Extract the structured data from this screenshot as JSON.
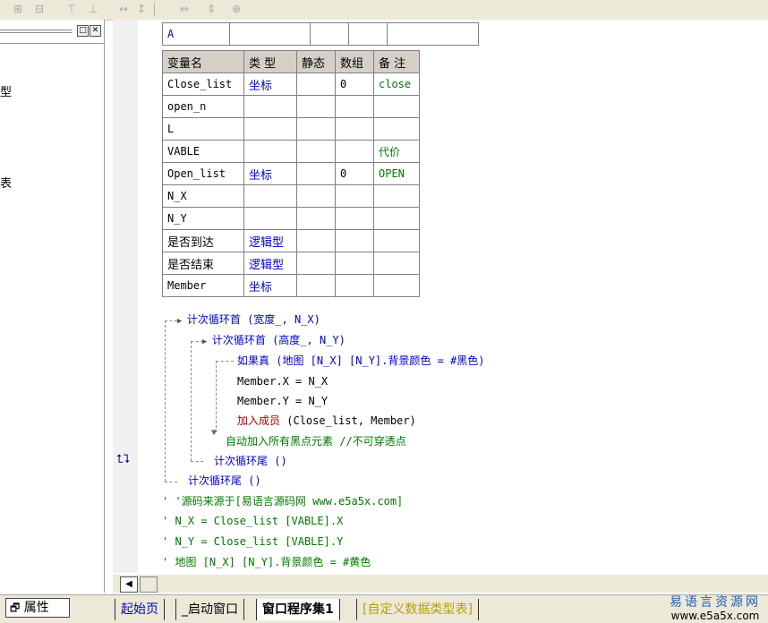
{
  "toolbar": {
    "icons": [
      "align-left-icon",
      "align-center-icon",
      "align-top-icon",
      "align-middle-icon",
      "equal-width-icon",
      "equal-height-icon",
      "equal-hspace-icon",
      "equal-vspace-icon",
      "center-both-icon"
    ]
  },
  "left_panel": {
    "fragments": [
      "型",
      "表"
    ]
  },
  "editor": {
    "header_row": [
      "A",
      "",
      "",
      "",
      ""
    ],
    "var_table": {
      "headers": [
        "变量名",
        "类 型",
        "静态",
        "数组",
        "备 注"
      ],
      "rows": [
        [
          "Close_list",
          "坐标",
          "",
          "0",
          "close"
        ],
        [
          "open_n",
          "",
          "",
          "",
          ""
        ],
        [
          "L",
          "",
          "",
          "",
          ""
        ],
        [
          "VABLE",
          "",
          "",
          "",
          "代价"
        ],
        [
          "Open_list",
          "坐标",
          "",
          "0",
          "OPEN"
        ],
        [
          "N_X",
          "",
          "",
          "",
          ""
        ],
        [
          "N_Y",
          "",
          "",
          "",
          ""
        ],
        [
          "是否到达",
          "逻辑型",
          "",
          "",
          ""
        ],
        [
          "是否结束",
          "逻辑型",
          "",
          "",
          ""
        ],
        [
          "Member",
          "坐标",
          "",
          "",
          ""
        ]
      ]
    },
    "code": {
      "line1": "计次循环首 (宽度_, N_X)",
      "line2": "计次循环首 (高度_, N_Y)",
      "line3": "如果真 (地图 [N_X] [N_Y].背景颜色 = #黑色)",
      "line4": "Member.X = N_X",
      "line5": "Member.Y = N_Y",
      "line6_kw": "加入成员",
      "line6_args": " (Close_list, Member)",
      "line7": "自动加入所有黑点元素 //不可穿透点",
      "line8": "计次循环尾 ()",
      "line9": "计次循环尾 ()",
      "line10": "' '源码来源于[易语言源码网 www.e5a5x.com]",
      "line11": "' N_X = Close_list [VABLE].X",
      "line12": "' N_Y = Close_list [VABLE].Y",
      "line13": "' 地图 [N_X] [N_Y].背景颜色 = #黄色"
    }
  },
  "bottom": {
    "properties_tab": "属性",
    "tabs": [
      "起始页",
      "_启动窗口",
      "窗口程序集1",
      "[自定义数据类型表]"
    ]
  },
  "brand": {
    "name": "易语言资源网",
    "url": "www.e5a5x.com"
  },
  "colors": {
    "keyword": "#0000cc",
    "comment": "#007700",
    "command": "#b00000"
  }
}
